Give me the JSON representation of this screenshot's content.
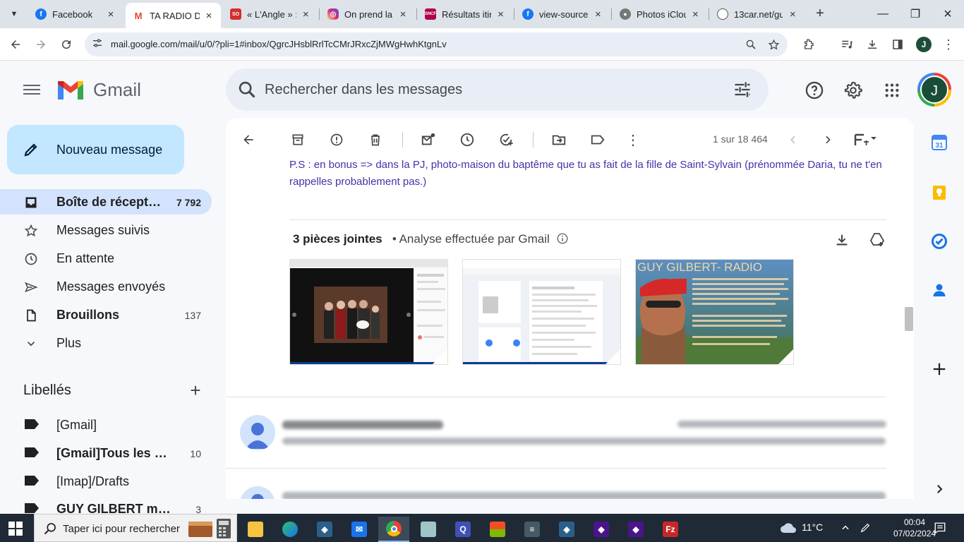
{
  "browser": {
    "tabs": [
      {
        "label": "Facebook",
        "favicon": "facebook-icon",
        "color": "#1877f2",
        "active": false
      },
      {
        "label": "TA RADIO DE",
        "favicon": "gmail-icon",
        "color": "#ea4335",
        "active": true
      },
      {
        "label": "« L'Angle » :",
        "favicon": "news-icon",
        "color": "#d32f2f",
        "active": false
      },
      {
        "label": "On prend la",
        "favicon": "instagram-icon",
        "color": "#d62976",
        "active": false
      },
      {
        "label": "Résultats itin",
        "favicon": "sncf-icon",
        "color": "#b0004f",
        "active": false
      },
      {
        "label": "view-source:",
        "favicon": "facebook-icon",
        "color": "#1877f2",
        "active": false
      },
      {
        "label": "Photos iClou",
        "favicon": "apple-icon",
        "color": "#555555",
        "active": false
      },
      {
        "label": "13car.net/gu",
        "favicon": "globe-icon",
        "color": "#555555",
        "active": false
      }
    ],
    "url": "mail.google.com/mail/u/0/?pli=1#inbox/QgrcJHsblRrlTcCMrJRxcZjMWgHwhKtgnLv",
    "profile_initial": "J"
  },
  "gmail": {
    "logo_text": "Gmail",
    "search_placeholder": "Rechercher dans les messages",
    "account_initial": "J",
    "compose_label": "Nouveau message",
    "nav": [
      {
        "label": "Boîte de récept…",
        "count": "7 792",
        "icon": "inbox-icon",
        "bold": true,
        "active": true
      },
      {
        "label": "Messages suivis",
        "count": "",
        "icon": "star-icon",
        "bold": false,
        "active": false
      },
      {
        "label": "En attente",
        "count": "",
        "icon": "clock-icon",
        "bold": false,
        "active": false
      },
      {
        "label": "Messages envoyés",
        "count": "",
        "icon": "send-icon",
        "bold": false,
        "active": false
      },
      {
        "label": "Brouillons",
        "count": "137",
        "icon": "draft-icon",
        "bold": true,
        "active": false
      },
      {
        "label": "Plus",
        "count": "",
        "icon": "chevron-down-icon",
        "bold": false,
        "active": false
      }
    ],
    "labels_title": "Libellés",
    "labels": [
      {
        "label": "[Gmail]",
        "count": "",
        "bold": false
      },
      {
        "label": "[Gmail]Tous les m…",
        "count": "10",
        "bold": true
      },
      {
        "label": "[Imap]/Drafts",
        "count": "",
        "bold": false
      },
      {
        "label": "GUY GILBERT mail…",
        "count": "3",
        "bold": true
      }
    ],
    "pager": "1 sur 18 464",
    "message": {
      "ps_text": "P.S : en bonus => dans la PJ, photo-maison du baptême que tu as fait de la fille de Saint-Sylvain (prénommée Daria, tu ne t'en rappelles probablement pas.)",
      "attachments_count_label": "3 pièces jointes",
      "attachments_scan_label": "• Analyse effectuée par Gmail",
      "thumb3_title": "GUY GILBERT- RADIO"
    }
  },
  "taskbar": {
    "search_placeholder": "Taper ici pour rechercher",
    "weather": "11°C",
    "time": "00:04",
    "date": "07/02/2024"
  }
}
